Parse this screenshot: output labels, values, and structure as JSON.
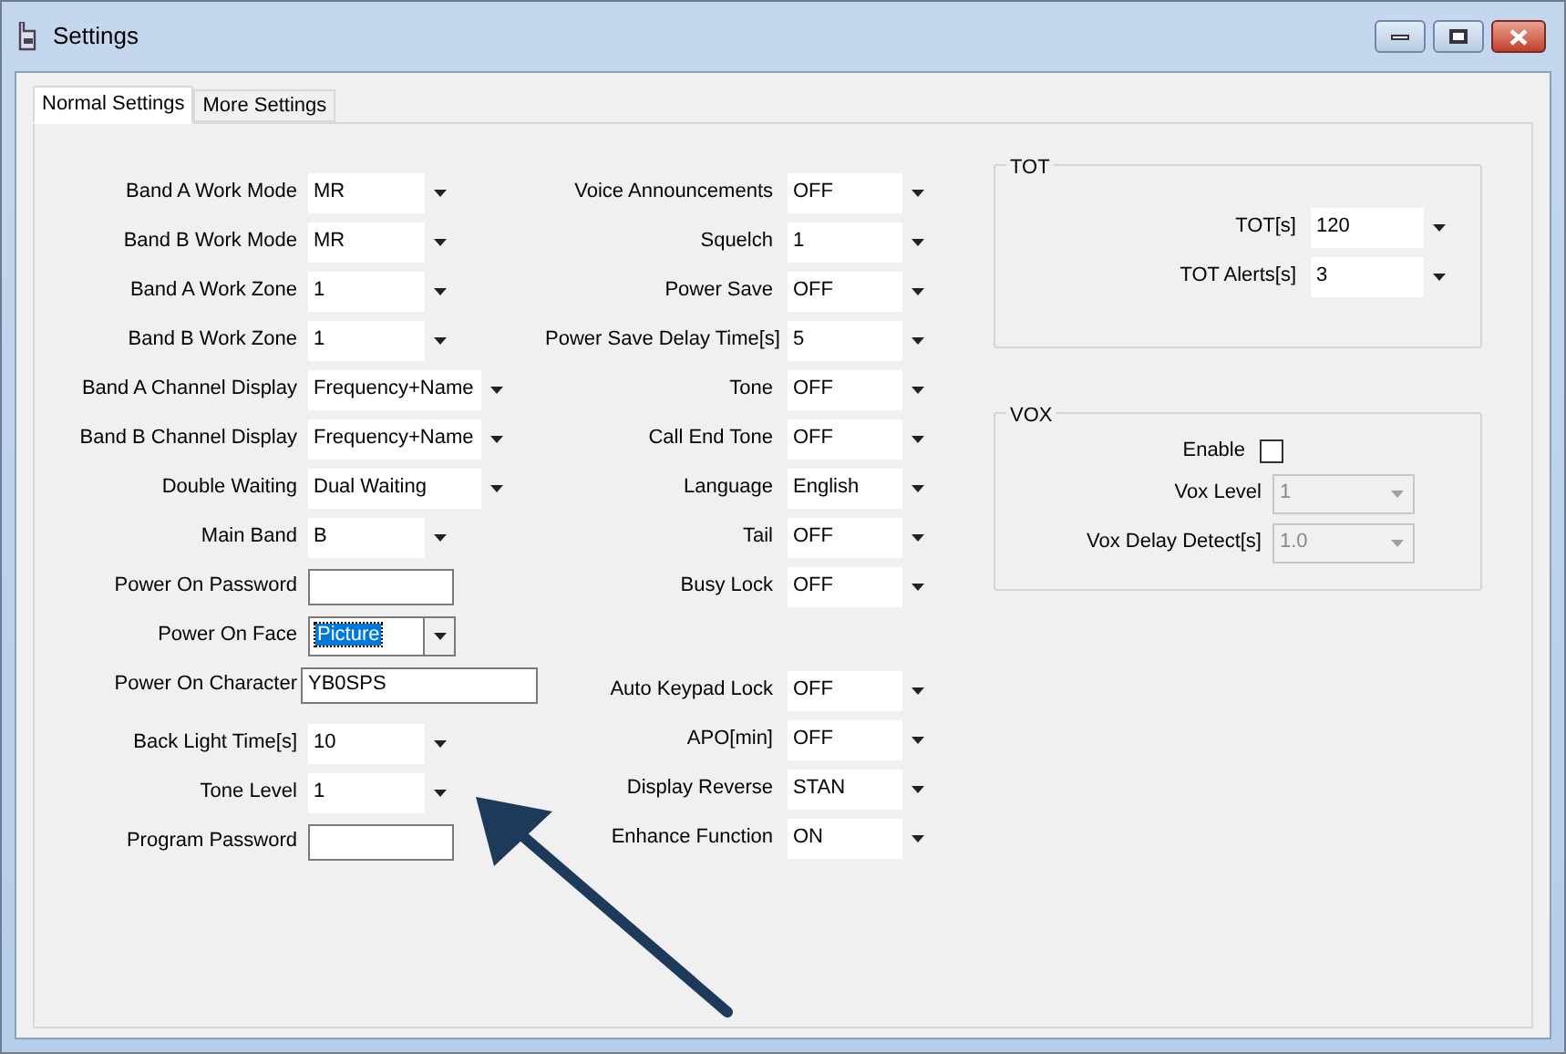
{
  "window": {
    "title": "Settings"
  },
  "tabs": [
    {
      "label": "Normal Settings",
      "selected": true
    },
    {
      "label": "More Settings",
      "selected": false
    }
  ],
  "left_fields": [
    {
      "label": "Band A Work Mode",
      "kind": "combo",
      "value": "MR",
      "wide": false,
      "focused": false
    },
    {
      "label": "Band B Work Mode",
      "kind": "combo",
      "value": "MR",
      "wide": false,
      "focused": false
    },
    {
      "label": "Band A Work Zone",
      "kind": "combo",
      "value": "1",
      "wide": false,
      "focused": false
    },
    {
      "label": "Band B Work Zone",
      "kind": "combo",
      "value": "1",
      "wide": false,
      "focused": false
    },
    {
      "label": "Band A Channel Display",
      "kind": "combo",
      "value": "Frequency+Name",
      "wide": true,
      "focused": false
    },
    {
      "label": "Band B Channel Display",
      "kind": "combo",
      "value": "Frequency+Name",
      "wide": true,
      "focused": false
    },
    {
      "label": "Double Waiting",
      "kind": "combo",
      "value": "Dual Waiting",
      "wide": true,
      "focused": false
    },
    {
      "label": "Main Band",
      "kind": "combo",
      "value": "B",
      "wide": false,
      "focused": false
    },
    {
      "label": "Power On Password",
      "kind": "text",
      "wide": false,
      "focused": false
    },
    {
      "label": "Power On Face",
      "kind": "combo",
      "value": "Picture",
      "wide": false,
      "focused": true
    },
    {
      "label": "Power On Character",
      "kind": "text",
      "value": "YB0SPS",
      "wide": true,
      "focused": false
    },
    {
      "label": "Back Light Time[s]",
      "kind": "combo",
      "value": "10",
      "wide": false,
      "focused": false
    },
    {
      "label": "Tone Level",
      "kind": "combo",
      "value": "1",
      "wide": false,
      "focused": false
    },
    {
      "label": "Program Password",
      "kind": "text",
      "wide": false,
      "focused": false
    }
  ],
  "middle_fields": [
    {
      "label": "Voice Announcements",
      "value": "OFF"
    },
    {
      "label": "Squelch",
      "value": "1"
    },
    {
      "label": "Power Save",
      "value": "OFF"
    },
    {
      "label": "Power Save Delay Time[s]",
      "value": "5"
    },
    {
      "label": "Tone",
      "value": "OFF"
    },
    {
      "label": "Call End Tone",
      "value": "OFF"
    },
    {
      "label": "Language",
      "value": "English"
    },
    {
      "label": "Tail",
      "value": "OFF"
    },
    {
      "label": "Busy Lock",
      "value": "OFF"
    }
  ],
  "middle_fields_lower": [
    {
      "label": "Auto Keypad Lock",
      "value": "OFF"
    },
    {
      "label": "APO[min]",
      "value": "OFF"
    },
    {
      "label": "Display Reverse",
      "value": "STAN"
    },
    {
      "label": "Enhance Function",
      "value": "ON"
    }
  ],
  "tot": {
    "title": "TOT",
    "fields": [
      {
        "label": "TOT[s]",
        "value": "120",
        "disabled": false
      },
      {
        "label": "TOT Alerts[s]",
        "value": "3",
        "disabled": false
      }
    ]
  },
  "vox": {
    "title": "VOX",
    "enable": {
      "label": "Enable",
      "checked": false
    },
    "fields": [
      {
        "label": "Vox Level",
        "value": "1",
        "disabled": true
      },
      {
        "label": "Vox Delay Detect[s]",
        "value": "1.0",
        "disabled": true
      }
    ]
  }
}
